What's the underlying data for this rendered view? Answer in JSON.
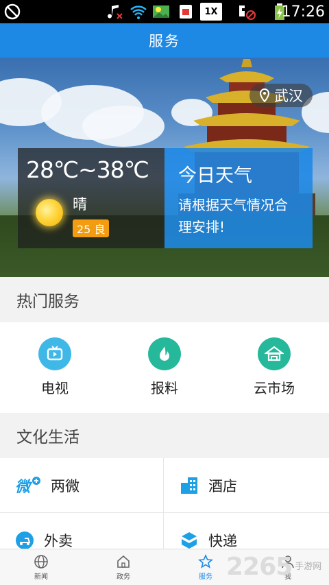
{
  "status_bar": {
    "time": "17:26",
    "signal_badge": "1X"
  },
  "title_bar": {
    "title": "服务"
  },
  "banner": {
    "location": "武汉",
    "weather": {
      "temperature": "28℃~38℃",
      "condition": "晴",
      "aqi": "25 良"
    },
    "tip": {
      "title": "今日天气",
      "text": "请根据天气情况合理安排!"
    }
  },
  "hot_services": {
    "header": "热门服务",
    "items": [
      {
        "label": "电视",
        "icon": "tv-icon",
        "color": "#3fb8e8"
      },
      {
        "label": "报料",
        "icon": "report-icon",
        "color": "#26b89a"
      },
      {
        "label": "云市场",
        "icon": "cloud-market-icon",
        "color": "#26b89a"
      }
    ]
  },
  "culture_life": {
    "header": "文化生活",
    "items": [
      {
        "label": "两微",
        "icon": "weibo-wechat-icon",
        "color": "#1ea0e6"
      },
      {
        "label": "酒店",
        "icon": "hotel-icon",
        "color": "#1ea0e6"
      },
      {
        "label": "外卖",
        "icon": "takeout-icon",
        "color": "#1ea0e6"
      },
      {
        "label": "快递",
        "icon": "express-icon",
        "color": "#1ea0e6"
      }
    ]
  },
  "bottom_nav": {
    "items": [
      {
        "label": "新闻",
        "icon": "globe-icon"
      },
      {
        "label": "政务",
        "icon": "home-icon"
      },
      {
        "label": "服务",
        "icon": "service-icon",
        "active": true
      },
      {
        "label": "我",
        "icon": "user-icon"
      }
    ]
  },
  "watermark": {
    "number": "2265",
    "site": "手游网"
  },
  "colors": {
    "primary": "#1e88e5",
    "accent_green": "#26b89a",
    "aqi_orange": "#f39c12"
  }
}
